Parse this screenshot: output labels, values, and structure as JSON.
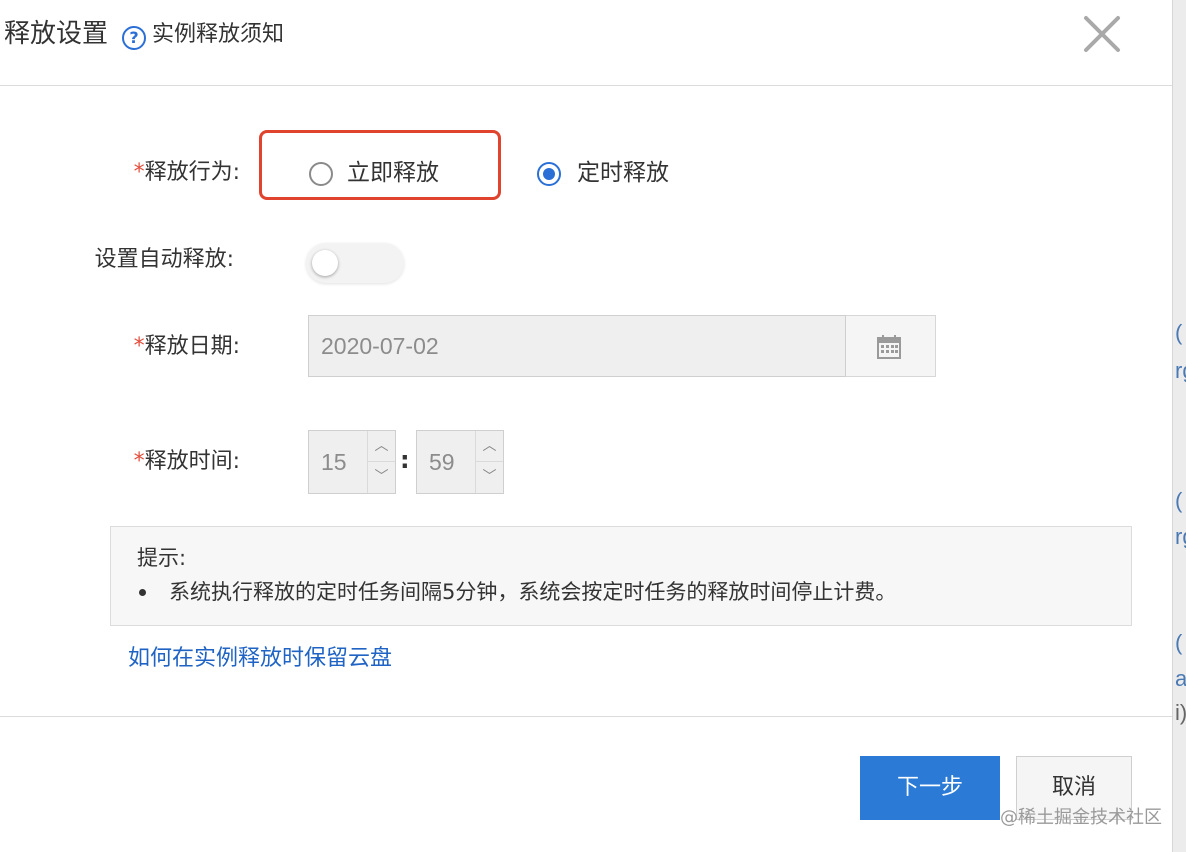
{
  "header": {
    "title": "释放设置",
    "help_icon_glyph": "?",
    "help_link": "实例释放须知",
    "close_icon": "close-icon"
  },
  "form": {
    "release_action": {
      "required_mark": "*",
      "label": "释放行为:",
      "options": [
        {
          "label": "立即释放",
          "checked": false
        },
        {
          "label": "定时释放",
          "checked": true
        }
      ]
    },
    "auto_release": {
      "label": "设置自动释放:",
      "enabled": false
    },
    "release_date": {
      "required_mark": "*",
      "label": "释放日期:",
      "value": "2020-07-02",
      "icon": "calendar-icon"
    },
    "release_time": {
      "required_mark": "*",
      "label": "释放时间:",
      "hour": "15",
      "minute": "59",
      "separator": ":",
      "up_glyph": "︿",
      "down_glyph": "﹀"
    }
  },
  "tip": {
    "title": "提示:",
    "items": [
      "系统执行释放的定时任务间隔5分钟，系统会按定时任务的释放时间停止计费。"
    ]
  },
  "link": "如何在实例释放时保留云盘",
  "footer": {
    "next_label": "下一步",
    "cancel_label": "取消"
  },
  "background_fragments": [
    "(",
    "rg",
    "(",
    "rg",
    "(",
    "ar",
    "i)"
  ],
  "watermark": "@稀土掘金技术社区",
  "colors": {
    "accent": "#2a6fd6",
    "primary_button": "#2a7ad6",
    "required": "#e34d3b",
    "highlight_box": "#e0432e",
    "link": "#1f63c4"
  }
}
